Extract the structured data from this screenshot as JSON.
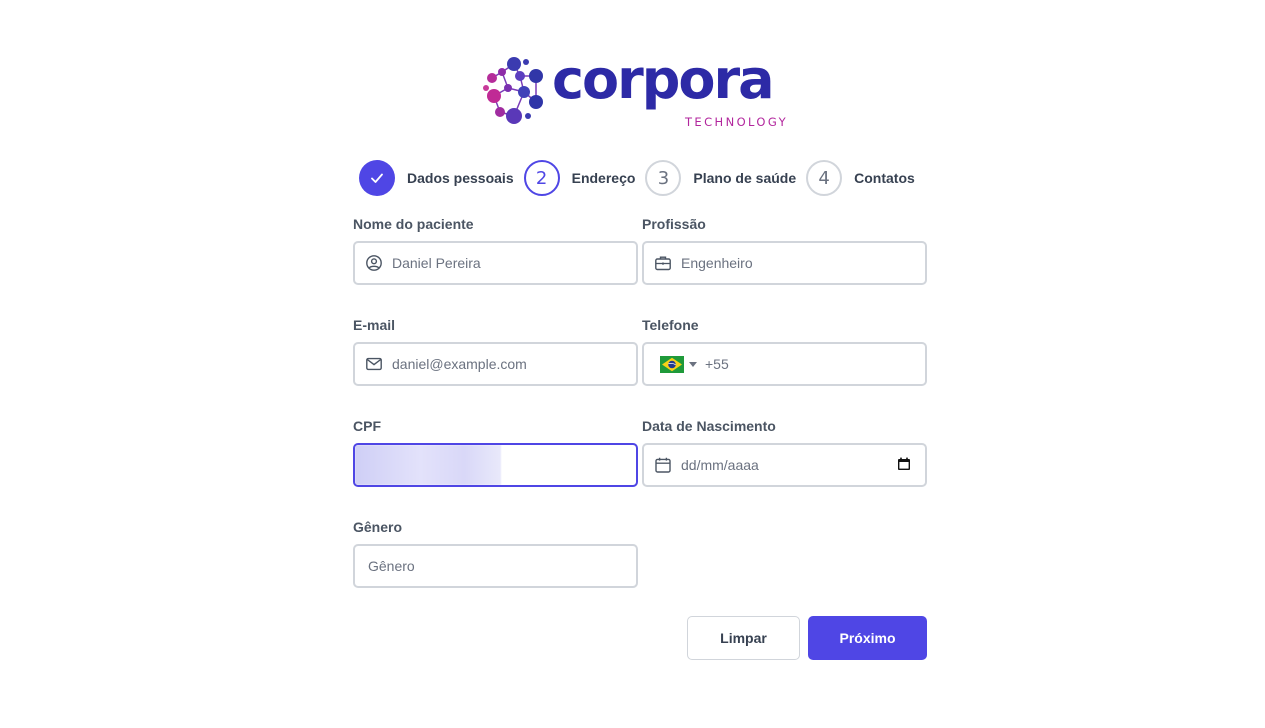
{
  "logo": {
    "brand": "corpora",
    "tagline": "TECHNOLOGY"
  },
  "stepper": {
    "steps": [
      {
        "number": "✓",
        "label": "Dados pessoais",
        "state": "done"
      },
      {
        "number": "2",
        "label": "Endereço",
        "state": "active"
      },
      {
        "number": "3",
        "label": "Plano de saúde",
        "state": "todo"
      },
      {
        "number": "4",
        "label": "Contatos",
        "state": "todo"
      }
    ]
  },
  "form": {
    "patient_name": {
      "label": "Nome do paciente",
      "placeholder": "Daniel Pereira",
      "icon": "user-circle-icon"
    },
    "profession": {
      "label": "Profissão",
      "placeholder": "Engenheiro",
      "icon": "briefcase-icon"
    },
    "email": {
      "label": "E-mail",
      "placeholder": "daniel@example.com",
      "icon": "mail-icon"
    },
    "phone": {
      "label": "Telefone",
      "country": "brazil-flag-icon",
      "value": "+55"
    },
    "cpf": {
      "label": "CPF",
      "value": ""
    },
    "birth_date": {
      "label": "Data de Nascimento",
      "placeholder": "dd/mm/aaaa",
      "icon": "calendar-icon"
    },
    "gender": {
      "label": "Gênero",
      "placeholder": "Gênero"
    }
  },
  "actions": {
    "clear_label": "Limpar",
    "next_label": "Próximo"
  },
  "colors": {
    "accent": "#4f46e5",
    "brand_dark": "#2d2aa6",
    "brand_magenta": "#b2269d",
    "border": "#d1d5db"
  }
}
